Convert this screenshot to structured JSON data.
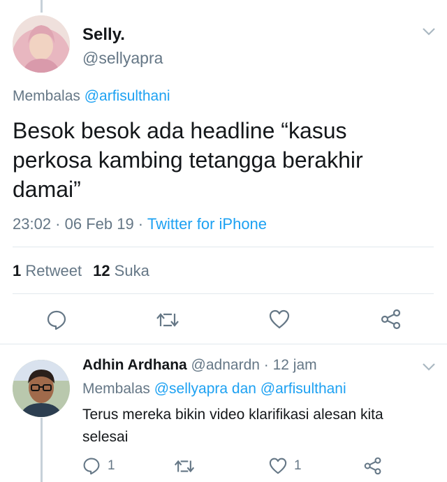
{
  "tweet": {
    "name": "Selly.",
    "handle": "@sellyapra",
    "reply_prefix": "Membalas ",
    "reply_mention": "@arfisulthani",
    "text": "Besok besok ada headline “kasus perkosa kambing tetangga berakhir damai”",
    "time": "23:02 · 06 Feb 19 · ",
    "source": "Twitter for iPhone",
    "retweet_count": "1",
    "retweet_label": " Retweet",
    "like_count": "12",
    "like_label": " Suka"
  },
  "reply": {
    "name": "Adhin Ardhana",
    "handle": " @adnardn",
    "time": " · 12 jam",
    "reply_prefix": "Membalas ",
    "reply_mentions": "@sellyapra dan @arfisulthani",
    "text": "Terus mereka bikin video klarifikasi alesan kita selesai",
    "reply_count": "1",
    "like_count": "1"
  },
  "colors": {
    "link": "#1da1f2",
    "secondary_text": "#657786",
    "icon": "#657786"
  },
  "icons": [
    "reply-icon",
    "retweet-icon",
    "like-icon",
    "share-icon",
    "chevron-down-icon"
  ]
}
